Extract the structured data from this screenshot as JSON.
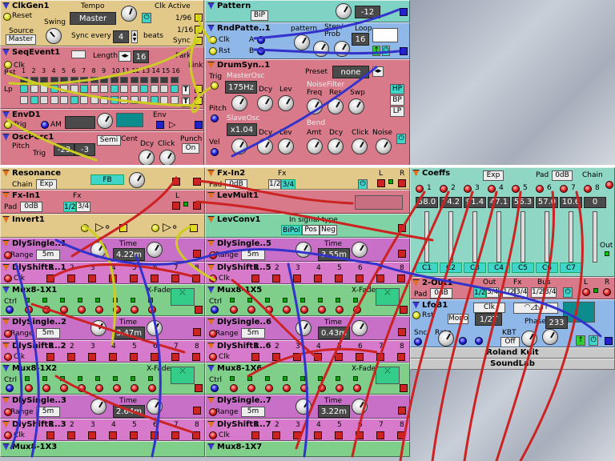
{
  "top": {
    "clkgen": {
      "name": "ClkGen1",
      "reset": "Reset",
      "tempo_label": "Tempo",
      "tempo_value": "Master",
      "clk_active": "Clk Active",
      "div1": "1/96",
      "div2": "1/16",
      "sync_label": "Sync",
      "source_label": "Source",
      "source_value": "Master",
      "swing_label": "Swing",
      "sync_every": "Sync every",
      "sync_value": "4",
      "beats": "beats"
    },
    "pattern": {
      "name": "Pattern",
      "bip": "BiP",
      "value": "-12"
    },
    "rndpatt": {
      "name": "RndPatte..1",
      "pattern_label": "pattern",
      "stepprob": "Step/",
      "prob": "Prob",
      "loop": "Loop",
      "loop_value": "16",
      "clk": "Clk",
      "rst": "Rst",
      "a": "A",
      "b": "B"
    },
    "seqevent": {
      "name": "SeqEvent1",
      "clk": "Clk",
      "rst": "Rst",
      "length": "Length",
      "length_value": "16",
      "park": "Park",
      "link": "Link",
      "lp": "Lp",
      "steps": [
        "1",
        "2",
        "3",
        "4",
        "5",
        "6",
        "7",
        "8",
        "9",
        "10",
        "11",
        "12",
        "13",
        "14",
        "15",
        "16"
      ]
    },
    "drumsyn": {
      "name": "DrumSyn..1",
      "preset": "Preset",
      "preset_value": "none",
      "trig": "Trig",
      "masterosc": "MasterOsc",
      "freq_value": "175Hz",
      "dcy": "Dcy",
      "lev": "Lev",
      "noisefilter": "NoiseFilter",
      "freq": "Freq",
      "res": "Res",
      "swp": "Swp",
      "hp": "HP",
      "bp": "BP",
      "lp": "LP",
      "pitch": "Pitch",
      "slaveosc": "SlaveOsc",
      "ratio_value": "x1.04",
      "bend": "Bend",
      "amt": "Amt",
      "click": "Click",
      "noise": "Noise",
      "vel": "Vel"
    },
    "envd": {
      "name": "EnvD1",
      "trig": "Trig",
      "am": "AM",
      "env": "Env"
    },
    "oscperc": {
      "name": "OscPerc1",
      "pitch": "Pitch",
      "trig": "Trig",
      "semi": "Semi",
      "cent": "Cent",
      "dcy": "Dcy",
      "click": "Click",
      "punch": "Punch",
      "punch_value": "On",
      "pitch_value": "-23",
      "cent_value": "-3"
    }
  },
  "left": {
    "resonance": {
      "name": "Resonance",
      "chain": "Chain",
      "exp": "Exp",
      "fb": "FB"
    },
    "fxin2": {
      "name": "Fx-In2",
      "pad": "Pad",
      "pad_value": "0dB",
      "fx": "Fx",
      "fx12": "1/2",
      "fx34": "3/4",
      "l": "L",
      "r": "R"
    },
    "fxin1": {
      "name": "Fx-In1",
      "pad": "Pad",
      "pad_value": "0dB",
      "fx": "Fx",
      "fx12": "1/2",
      "fx34": "3/4",
      "l": "L",
      "r": "R"
    },
    "levmult": {
      "name": "LevMult1"
    },
    "invert": {
      "name": "Invert1"
    },
    "levconv": {
      "name": "LevConv1",
      "insig": "In signal type",
      "bipol": "BiPol",
      "pos": "Pos",
      "neg": "Neg"
    },
    "dlyA": [
      {
        "name": "DlySingle..1",
        "range": "Range",
        "range_value": "5m",
        "time": "Time",
        "time_value": "4.22m"
      },
      {
        "name": "DlySingle..2",
        "range": "Range",
        "range_value": "5m",
        "time": "Time",
        "time_value": "3.47m"
      },
      {
        "name": "DlySingle..3",
        "range": "Range",
        "range_value": "5m",
        "time": "Time",
        "time_value": "2.64m"
      }
    ],
    "dlyB": [
      {
        "name": "DlySingle..5",
        "range": "Range",
        "range_value": "5m",
        "time": "Time",
        "time_value": "3.55m"
      },
      {
        "name": "DlySingle..6",
        "range": "Range",
        "range_value": "5m",
        "time": "Time",
        "time_value": "0.43m"
      },
      {
        "name": "DlySingle..7",
        "range": "Range",
        "range_value": "5m",
        "time": "Time",
        "time_value": "3.22m"
      }
    ],
    "shiftA": [
      {
        "name": "DlyShiftR..1",
        "clk": "Clk"
      },
      {
        "name": "DlyShiftR..2",
        "clk": "Clk"
      },
      {
        "name": "DlyShiftR..3",
        "clk": "Clk"
      }
    ],
    "shiftB": [
      {
        "name": "DlyShiftR..5",
        "clk": "Clk"
      },
      {
        "name": "DlyShiftR..6",
        "clk": "Clk"
      },
      {
        "name": "DlyShiftR..7",
        "clk": "Clk"
      }
    ],
    "muxA": [
      {
        "name": "Mux8-1X1",
        "ctrl": "Ctrl",
        "xfade": "X-Fade"
      },
      {
        "name": "Mux8-1X2",
        "ctrl": "Ctrl",
        "xfade": "X-Fade"
      },
      {
        "name": "Mux8-1X3"
      }
    ],
    "muxB": [
      {
        "name": "Mux8-1X5",
        "ctrl": "Ctrl",
        "xfade": "X-Fade"
      },
      {
        "name": "Mux8-1X6",
        "ctrl": "Ctrl",
        "xfade": "X-Fade"
      },
      {
        "name": "Mux8-1X7"
      }
    ],
    "nums": [
      "1",
      "2",
      "3",
      "4",
      "5",
      "6",
      "7",
      "8"
    ]
  },
  "right": {
    "coeffs": {
      "name": "Coeffs",
      "exp": "Exp",
      "pad": "Pad",
      "pad_value": "0dB",
      "chain": "Chain",
      "out": "Out",
      "nums": [
        "1",
        "2",
        "3",
        "4",
        "5",
        "6",
        "7",
        "8"
      ],
      "values": [
        "58.0",
        "74.2",
        "91.4",
        "47.1",
        "56.3",
        "57.0",
        "10.6",
        "0"
      ],
      "c_labels": [
        "C1",
        "C2",
        "C3",
        "C4",
        "C5",
        "C6",
        "C7"
      ]
    },
    "twoout": {
      "name": "2-Out1",
      "out": "Out",
      "fx": "Fx",
      "bus": "Bus",
      "pad": "Pad",
      "pad_value": "0dB",
      "o12": "1/2",
      "o34": "3/4",
      "f12": "1/2",
      "f34": "3/4",
      "b12": "1/2",
      "b34": "3/4",
      "l": "L",
      "r": "R"
    },
    "lfob": {
      "name": "LfoB1",
      "rst": "Rst",
      "clk": "Clk",
      "mono": "Mono",
      "rate_value": "1/2T",
      "phase": "Phase",
      "phase_value": "233",
      "snc": "Snc",
      "rate": "Rate",
      "kbt": "KBT",
      "kbt_value": "Off"
    },
    "credit1": "Roland Kuit",
    "credit2": "SoundLab"
  }
}
